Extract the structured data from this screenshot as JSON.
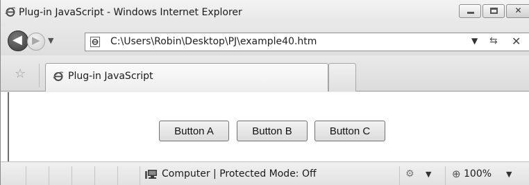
{
  "window": {
    "title": "Plug-in JavaScript - Windows Internet Explorer",
    "icons": {
      "app": "ie-logo-icon",
      "minimize": "minimize-icon",
      "maximize": "maximize-icon",
      "close": "close-icon"
    }
  },
  "nav": {
    "back_glyph": "⮜",
    "forward_glyph": "➜",
    "history_glyph": "▼",
    "address": "C:\\Users\\Robin\\Desktop\\PJ\\example40.htm",
    "address_dropdown_glyph": "▼",
    "refresh_glyph": "⇆",
    "stop_glyph": "✕"
  },
  "tabs": {
    "favorites_glyph": "☆",
    "active_tab_label": "Plug-in JavaScript"
  },
  "content": {
    "buttons": [
      "Button A",
      "Button B",
      "Button C"
    ]
  },
  "status": {
    "zone_text": "Computer | Protected Mode: Off",
    "tools_glyph": "⚙",
    "tools_dropdown_glyph": "▼",
    "zoom_glyph": "⊕",
    "zoom_level": "100%",
    "zoom_dropdown_glyph": "▼"
  }
}
